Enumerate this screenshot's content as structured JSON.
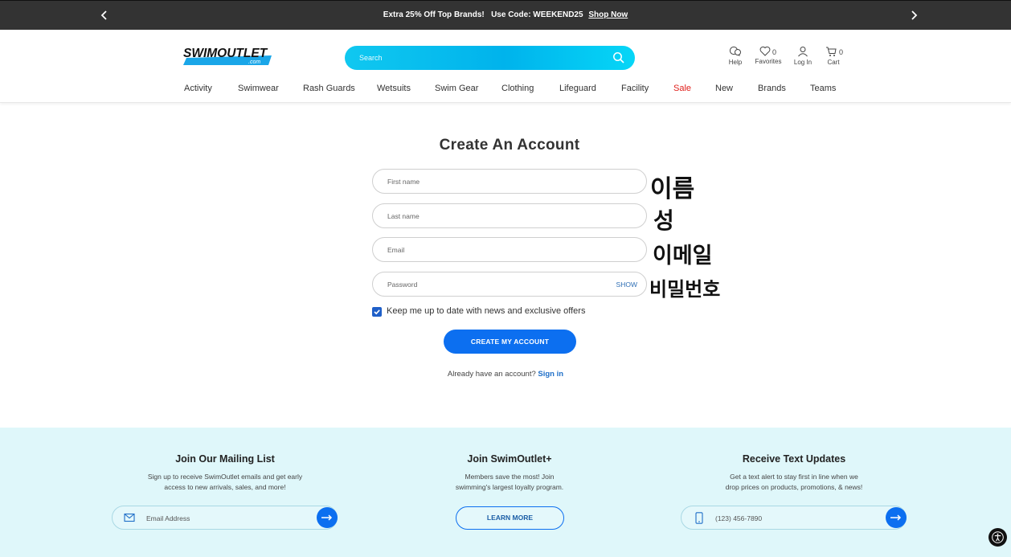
{
  "promo": {
    "message": "Extra 25% Off Top Brands!",
    "code_text": "Use Code: WEEKEND25",
    "link": "Shop Now",
    "prev_icon": "chevron-left-icon",
    "next_icon": "chevron-right-icon"
  },
  "header": {
    "logo_text": "SWIMOUTLET",
    "logo_sub": ".com",
    "search_placeholder": "Search",
    "help_label": "Help",
    "favorites_label": "Favorites",
    "favorites_count": "0",
    "login_label": "Log In",
    "cart_label": "Cart",
    "cart_count": "0"
  },
  "nav": {
    "items": [
      "Activity",
      "Swimwear",
      "Rash Guards",
      "Wetsuits",
      "Swim Gear",
      "Clothing",
      "Lifeguard",
      "Facility",
      "Sale",
      "New",
      "Brands",
      "Teams"
    ]
  },
  "form": {
    "title": "Create An Account",
    "first_name_placeholder": "First name",
    "last_name_placeholder": "Last name",
    "email_placeholder": "Email",
    "password_placeholder": "Password",
    "show_label": "SHOW",
    "newsletter_label": "Keep me up to date with news and exclusive offers",
    "newsletter_checked": true,
    "submit_label": "CREATE MY ACCOUNT",
    "signin_prompt": "Already have an account?",
    "signin_link": "Sign in"
  },
  "annotations": {
    "first_name": "이름",
    "last_name": "성",
    "email": "이메일",
    "password": "비밀번호"
  },
  "footer": {
    "mailing": {
      "title": "Join Our Mailing List",
      "desc_line1": "Sign up to receive SwimOutlet emails and get early",
      "desc_line2": "access to new arrivals, sales, and more!",
      "placeholder": "Email Address"
    },
    "plus": {
      "title": "Join SwimOutlet+",
      "desc_line1": "Members save the most! Join",
      "desc_line2": "swimming's largest loyalty program.",
      "button": "LEARN MORE"
    },
    "text": {
      "title": "Receive Text Updates",
      "desc_line1": "Get a text alert to stay first in line when we",
      "desc_line2": "drop prices on products, promotions, & news!",
      "placeholder": "(123) 456-7890"
    }
  },
  "colors": {
    "accent": "#0c6ff0",
    "search": "#00b3ec",
    "sale": "#e0201b",
    "footer_bg": "#dff7fa",
    "promo_bg": "#333333"
  }
}
